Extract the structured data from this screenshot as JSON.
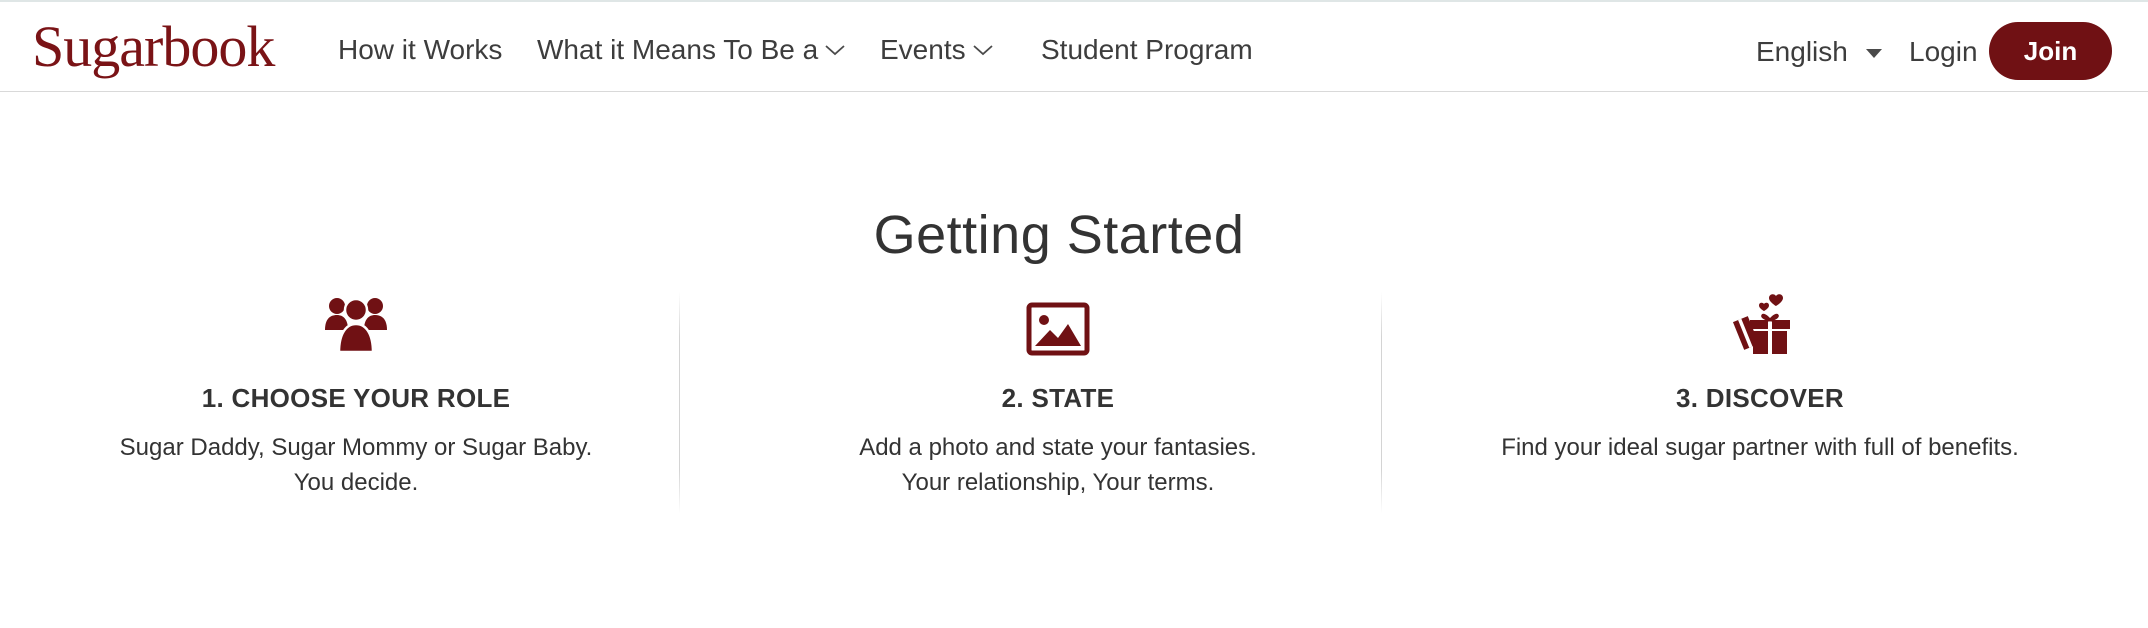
{
  "header": {
    "logo": "Sugarbook",
    "nav": [
      {
        "label": "How it Works"
      },
      {
        "label": "What it Means To Be a",
        "dropdown": true
      },
      {
        "label": "Events",
        "dropdown": true
      },
      {
        "label": "Student Program"
      }
    ],
    "language": "English",
    "login": "Login",
    "join": "Join"
  },
  "main": {
    "title": "Getting Started",
    "steps": [
      {
        "icon": "users-icon",
        "title": "1. CHOOSE YOUR ROLE",
        "lines": [
          "Sugar Daddy, Sugar Mommy or Sugar Baby.",
          "You decide."
        ]
      },
      {
        "icon": "image-icon",
        "title": "2. STATE",
        "lines": [
          "Add a photo and state your fantasies.",
          "Your relationship, Your terms."
        ]
      },
      {
        "icon": "gift-hearts-icon",
        "title": "3. DISCOVER",
        "lines": [
          "Find your ideal sugar partner with full of benefits."
        ]
      }
    ]
  },
  "colors": {
    "brand": "#701114",
    "text": "#333333",
    "border": "#d9d9d9"
  }
}
